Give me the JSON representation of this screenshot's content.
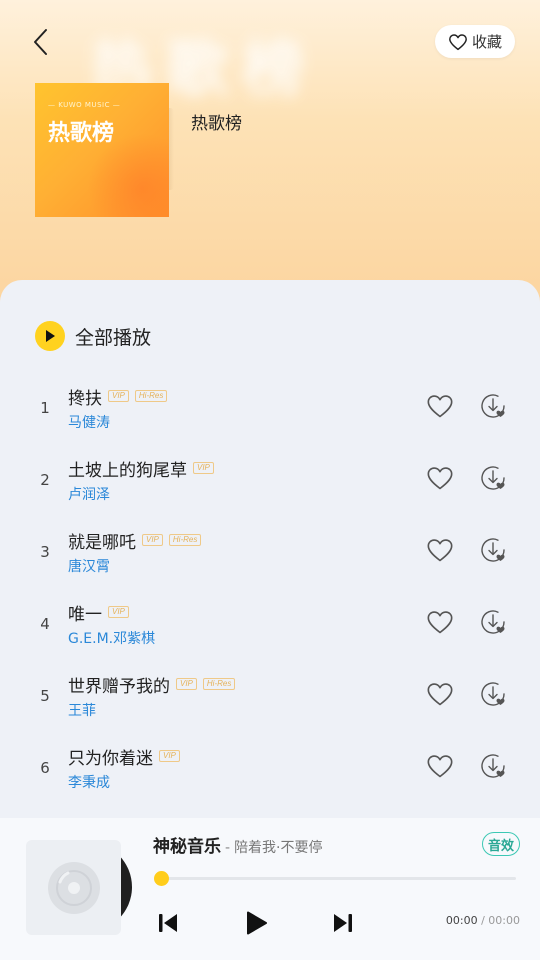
{
  "header": {
    "favorite_label": "收藏",
    "blurred_bg_title": "热歌榜"
  },
  "cover": {
    "brand": "— KUWO MUSIC —",
    "title": "热歌榜"
  },
  "playlist": {
    "title": "热歌榜",
    "play_all_label": "全部播放"
  },
  "songs": [
    {
      "index": "1",
      "title": "搀扶",
      "artist": "马健涛",
      "tags": [
        "VIP",
        "Hi-Res"
      ]
    },
    {
      "index": "2",
      "title": "土坡上的狗尾草",
      "artist": "卢润泽",
      "tags": [
        "VIP"
      ]
    },
    {
      "index": "3",
      "title": "就是哪吒",
      "artist": "唐汉霄",
      "tags": [
        "VIP",
        "Hi-Res"
      ]
    },
    {
      "index": "4",
      "title": "唯一",
      "artist": "G.E.M.邓紫棋",
      "tags": [
        "VIP"
      ]
    },
    {
      "index": "5",
      "title": "世界赠予我的",
      "artist": "王菲",
      "tags": [
        "VIP",
        "Hi-Res"
      ]
    },
    {
      "index": "6",
      "title": "只为你着迷",
      "artist": "李秉成",
      "tags": [
        "VIP"
      ]
    }
  ],
  "player": {
    "song": "神秘音乐",
    "separator": "-",
    "artist": "陪着我·不要停",
    "effect_label": "音效",
    "current_time": "00:00",
    "time_sep": " / ",
    "total_time": "00:00",
    "progress": 0
  },
  "colors": {
    "accent": "#ffd21f",
    "artist_link": "#2b88d8",
    "vip_tag": "#e5b25a",
    "effect": "#3cc8b4"
  },
  "icons": {
    "back": "chevron-left-icon",
    "favorite": "heart-icon",
    "play_all": "play-icon",
    "like": "heart-icon",
    "download": "download-icon",
    "prev": "skip-previous-icon",
    "play": "play-icon",
    "next": "skip-next-icon"
  }
}
